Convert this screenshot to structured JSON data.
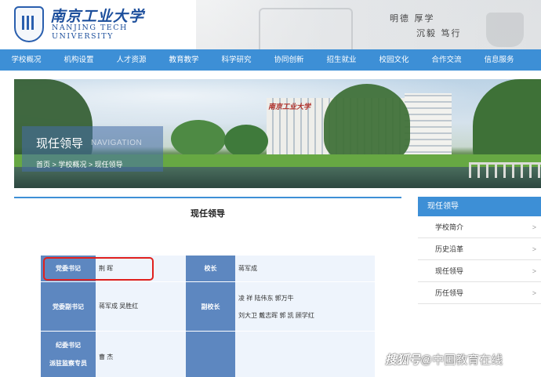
{
  "header": {
    "logo_cn": "南京工业大学",
    "logo_en_line1": "NANJING TECH",
    "logo_en_line2": "UNIVERSITY",
    "motto_line1": "明德  厚学",
    "motto_line2": "沉毅  笃行"
  },
  "nav": {
    "items": [
      "学校概况",
      "机构设置",
      "人才资源",
      "教育教学",
      "科学研究",
      "协同创新",
      "招生就业",
      "校园文化",
      "合作交流",
      "信息服务"
    ]
  },
  "banner": {
    "title": "现任领导",
    "title_en": "NAVIGATION",
    "sign": "南京工业大学",
    "breadcrumb": [
      "首页",
      "学校概况",
      "现任领导"
    ],
    "separator": ">"
  },
  "content": {
    "title": "现任领导",
    "rows": [
      {
        "left_label": "党委书记",
        "left_value": "荆  晖",
        "right_label": "校长",
        "right_value": "蒋军成"
      },
      {
        "left_label": "党委副书记",
        "left_value": "蒋军成    吴胜红",
        "right_label": "副校长",
        "right_value_line1": "凌  祥    陆伟东    郭万牛",
        "right_value_line2": "刘大卫    戴志晖    郭  凯    顾学红"
      },
      {
        "left_label_line1": "纪委书记",
        "left_label_line2": "派驻监察专员",
        "left_value": "曹  杰"
      }
    ]
  },
  "sidebar": {
    "title": "现任领导",
    "items": [
      "学校简介",
      "历史沿革",
      "现任领导",
      "历任领导"
    ]
  },
  "watermark": {
    "brand": "搜狐号",
    "text": "@中国教育在线"
  },
  "colors": {
    "nav_blue": "#3d8fd6",
    "label_blue": "#5d87c0",
    "highlight_red": "#e0211e"
  }
}
